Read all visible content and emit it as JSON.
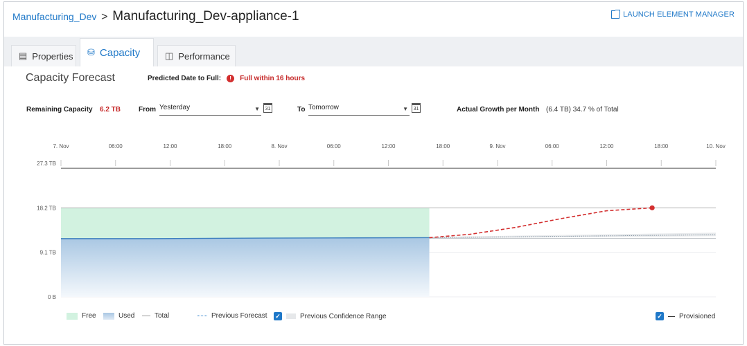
{
  "breadcrumb": {
    "parent": "Manufacturing_Dev",
    "separator": ">",
    "current": "Manufacturing_Dev-appliance-1"
  },
  "launch": {
    "label": "LAUNCH ELEMENT MANAGER",
    "icon": "external-link-icon"
  },
  "tabs": [
    {
      "label": "Properties",
      "icon": "document-icon"
    },
    {
      "label": "Capacity",
      "icon": "database-icon",
      "active": true
    },
    {
      "label": "Performance",
      "icon": "bar-chart-icon"
    }
  ],
  "forecast": {
    "title": "Capacity Forecast",
    "predicted_label": "Predicted Date to Full:",
    "predicted_value": "Full within 16 hours"
  },
  "controls": {
    "remaining_label": "Remaining Capacity",
    "remaining_value": "6.2 TB",
    "from_label": "From",
    "from_value": "Yesterday",
    "to_label": "To",
    "to_value": "Tomorrow",
    "growth_label": "Actual Growth per Month",
    "growth_value": "(6.4 TB) 34.7 % of Total"
  },
  "legend": {
    "free": "Free",
    "used": "Used",
    "total": "Total",
    "prev_forecast": "Previous Forecast",
    "prev_confidence": "Previous Confidence Range",
    "provisioned": "Provisioned"
  },
  "colors": {
    "accent": "#1f78c8",
    "alert": "#c62828",
    "free": "#d2f2e0",
    "used": "#a9c7e3",
    "forecast": "#d32f2f"
  },
  "chart_data": {
    "type": "area",
    "x_ticks": [
      "7. Nov",
      "06:00",
      "12:00",
      "18:00",
      "8. Nov",
      "06:00",
      "12:00",
      "18:00",
      "9. Nov",
      "06:00",
      "12:00",
      "18:00",
      "10. Nov"
    ],
    "x_range_hours": [
      0,
      72
    ],
    "y_ticks": [
      "0 B",
      "9.1 TB",
      "18.2 TB",
      "27.3 TB"
    ],
    "ylim": [
      0,
      27.3
    ],
    "unit": "TB",
    "total": 18.2,
    "provisioned": 26.3,
    "now_hours": 40.5,
    "used": {
      "name": "Used",
      "x": [
        0,
        10,
        20,
        30,
        40.5
      ],
      "y": [
        11.9,
        11.9,
        12.0,
        12.05,
        12.1
      ]
    },
    "forecast": {
      "x": [
        40.5,
        45,
        50,
        55,
        60,
        65
      ],
      "y": [
        12.1,
        12.8,
        14.2,
        16.0,
        17.6,
        18.2
      ]
    },
    "previous_forecast": {
      "name": "Previous Forecast",
      "x": [
        40.5,
        72
      ],
      "y": [
        12.1,
        12.7
      ]
    }
  }
}
